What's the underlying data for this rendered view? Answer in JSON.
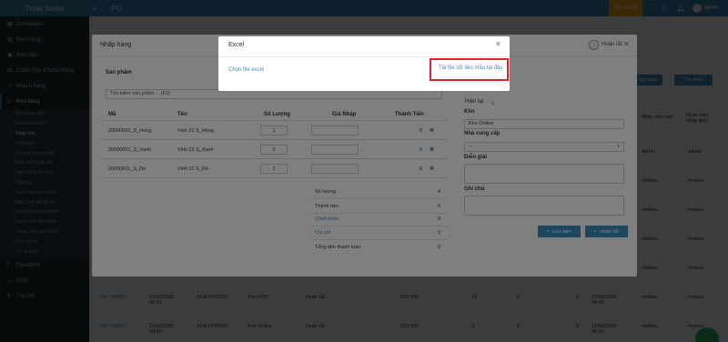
{
  "app": {
    "brand": "Trust Sales",
    "menu_toggle": "≡",
    "page_title": "PO",
    "cart_label": "Giỏ hàng",
    "user": "admin"
  },
  "sidebar": {
    "items": [
      {
        "label": "Dashboard",
        "icon": "dashboard-icon"
      },
      {
        "label": "Đơn hàng",
        "icon": "cart-icon"
      },
      {
        "label": "Bưu kiện",
        "icon": "box-icon"
      },
      {
        "label": "Chăm Sóc Khách Hàng",
        "icon": "headset-icon"
      },
      {
        "label": "Khách hàng",
        "icon": "users-icon"
      },
      {
        "label": "Kho hàng",
        "icon": "warehouse-icon"
      }
    ],
    "subitems": [
      "Nhà cung cấp",
      "Danh sách kho",
      "Nhập kho",
      "Xuất kho",
      "Chuyển kho nội bộ",
      "Điều chỉnh giá vốn",
      "Sản lượng tồn kho",
      "Tồn kho",
      "Danh mục sản phẩm",
      "Bảng tính lãi đặt NP",
      "Danh sách sản phẩm",
      "Danh mục sản phẩm",
      "Thuộc tính sản phẩm",
      "Đơn vị tính",
      "In mã vạch"
    ],
    "bottom_items": [
      {
        "label": "Facebook",
        "icon": "facebook-icon"
      },
      {
        "label": "POS",
        "icon": "pos-icon"
      },
      {
        "label": "Thu chi",
        "icon": "money-icon"
      }
    ]
  },
  "background": {
    "buttons": {
      "add": "Nhập hàng",
      "search": "Tìm kiếm"
    },
    "col_creator": "Nhân viên tạo",
    "col_importer": "Nhân viên nhập kho",
    "rows": [
      {
        "creator": "admin",
        "importer": "admin"
      },
      {
        "creator": "mykieu",
        "importer": "mykieu"
      },
      {
        "creator": "mykieu",
        "importer": "mykieu"
      },
      {
        "creator": "mykieu",
        "importer": "mykieu"
      },
      {
        "creator": "mykieu",
        "importer": "mykieu"
      },
      {
        "creator": "mykieu",
        "importer": "mykieu"
      }
    ],
    "po_rows": [
      {
        "id": "PO_000037",
        "date": "11/06/2020 09:42",
        "supplier": "ALIEXPRESS",
        "warehouse": "Kho POS",
        "status": "Hoàn tất",
        "amount": "500,000",
        "c1": "10",
        "c2": "0",
        "c3": "0",
        "date2": "11/06/2020 09:42",
        "creator": "mykieu",
        "importer": "mykieu"
      },
      {
        "id": "PO_000036",
        "date": "11/06/2020 08:50",
        "supplier": "ALIEXPRESS",
        "warehouse": "Kho Online",
        "status": "Hoàn tất",
        "amount": "100,000",
        "c1": "5",
        "c2": "0",
        "c3": "0",
        "date2": "11/06/2020 08:50",
        "creator": "mykieu",
        "importer": "mykieu"
      }
    ]
  },
  "import_modal": {
    "title": "Nhập hàng",
    "close_label": "Hoàn tất",
    "products_label": "Sản phẩm",
    "search_placeholder": "Tìm kiếm sản phẩm ... (F3)",
    "columns": [
      "Mã",
      "Tên",
      "Số Lượng",
      "Giá Nhập",
      "Thành Tiền"
    ],
    "rows": [
      {
        "code": "20000002_S_Hong",
        "name": "Vinh 21 S_Hồng",
        "qty": "1",
        "total": "0"
      },
      {
        "code": "20000001_S_Xanh",
        "name": "Vinh 22 S_Xanh",
        "qty": "2",
        "total": "0"
      },
      {
        "code": "20000001_S_Do",
        "name": "Vinh 22 S_Đỏ",
        "qty": "1",
        "total": "0"
      }
    ],
    "summary": [
      {
        "label": "Số lượng",
        "value": "4",
        "link": false
      },
      {
        "label": "Thành tiền",
        "value": "0",
        "link": false
      },
      {
        "label": "Chiết khấu",
        "value": "0",
        "link": true
      },
      {
        "label": "Chi phí",
        "value": "0",
        "link": true
      },
      {
        "label": "Tổng tiền thanh toán",
        "value": "0",
        "link": false
      }
    ],
    "right": {
      "now_label": "Hiện tại",
      "warehouse_label": "Kho",
      "warehouse_value": "Kho Online",
      "supplier_label": "Nhà cung cấp",
      "supplier_value": "--",
      "note_label": "Diễn giải",
      "memo_label": "Ghi chú",
      "save_draft": "Lưu tạm",
      "complete": "Hoàn tất"
    }
  },
  "excel_modal": {
    "title": "Excel",
    "choose_file": "Chọn file excel",
    "download_template": "Tải file dữ liệu mẫu tại đây"
  }
}
